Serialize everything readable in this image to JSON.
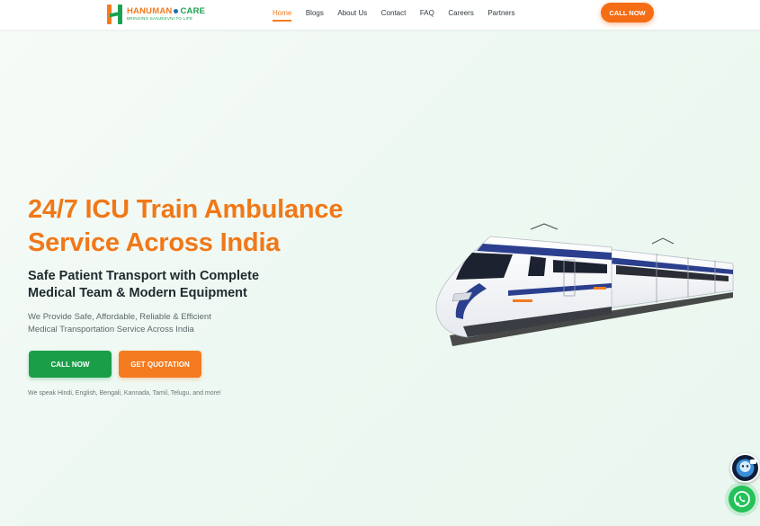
{
  "brand": {
    "name_part1": "HANUMAN",
    "name_part2": "CARE",
    "tagline": "BRINGING SANJEEVNI TO LIFE",
    "colors": {
      "orange": "#f47b20",
      "green": "#1aa251",
      "blue": "#1f6fb2"
    }
  },
  "nav": {
    "items": [
      {
        "label": "Home",
        "active": true
      },
      {
        "label": "Blogs",
        "active": false
      },
      {
        "label": "About Us",
        "active": false
      },
      {
        "label": "Contact",
        "active": false
      },
      {
        "label": "FAQ",
        "active": false
      },
      {
        "label": "Careers",
        "active": false
      },
      {
        "label": "Partners",
        "active": false
      }
    ],
    "cta_label": "CALL NOW"
  },
  "hero": {
    "title_line1": "24/7 ICU Train Ambulance",
    "title_line2": "Service Across India",
    "subtitle_line1": "Safe Patient Transport with Complete",
    "subtitle_line2": "Medical Team & Modern Equipment",
    "desc_line1": "We Provide Safe, Affordable, Reliable & Efficient",
    "desc_line2": "Medical Transportation Service Across India",
    "call_button": "CALL NOW",
    "quote_button": "GET QUOTATION",
    "languages": "We speak Hindi, English, Bengali, Kannada, Tamil, Telugu, and more!"
  },
  "floating": {
    "chatbot_icon": "chatbot-icon",
    "whatsapp_icon": "whatsapp-icon"
  },
  "icons": {
    "train_image": "vande-bharat-train-image"
  }
}
